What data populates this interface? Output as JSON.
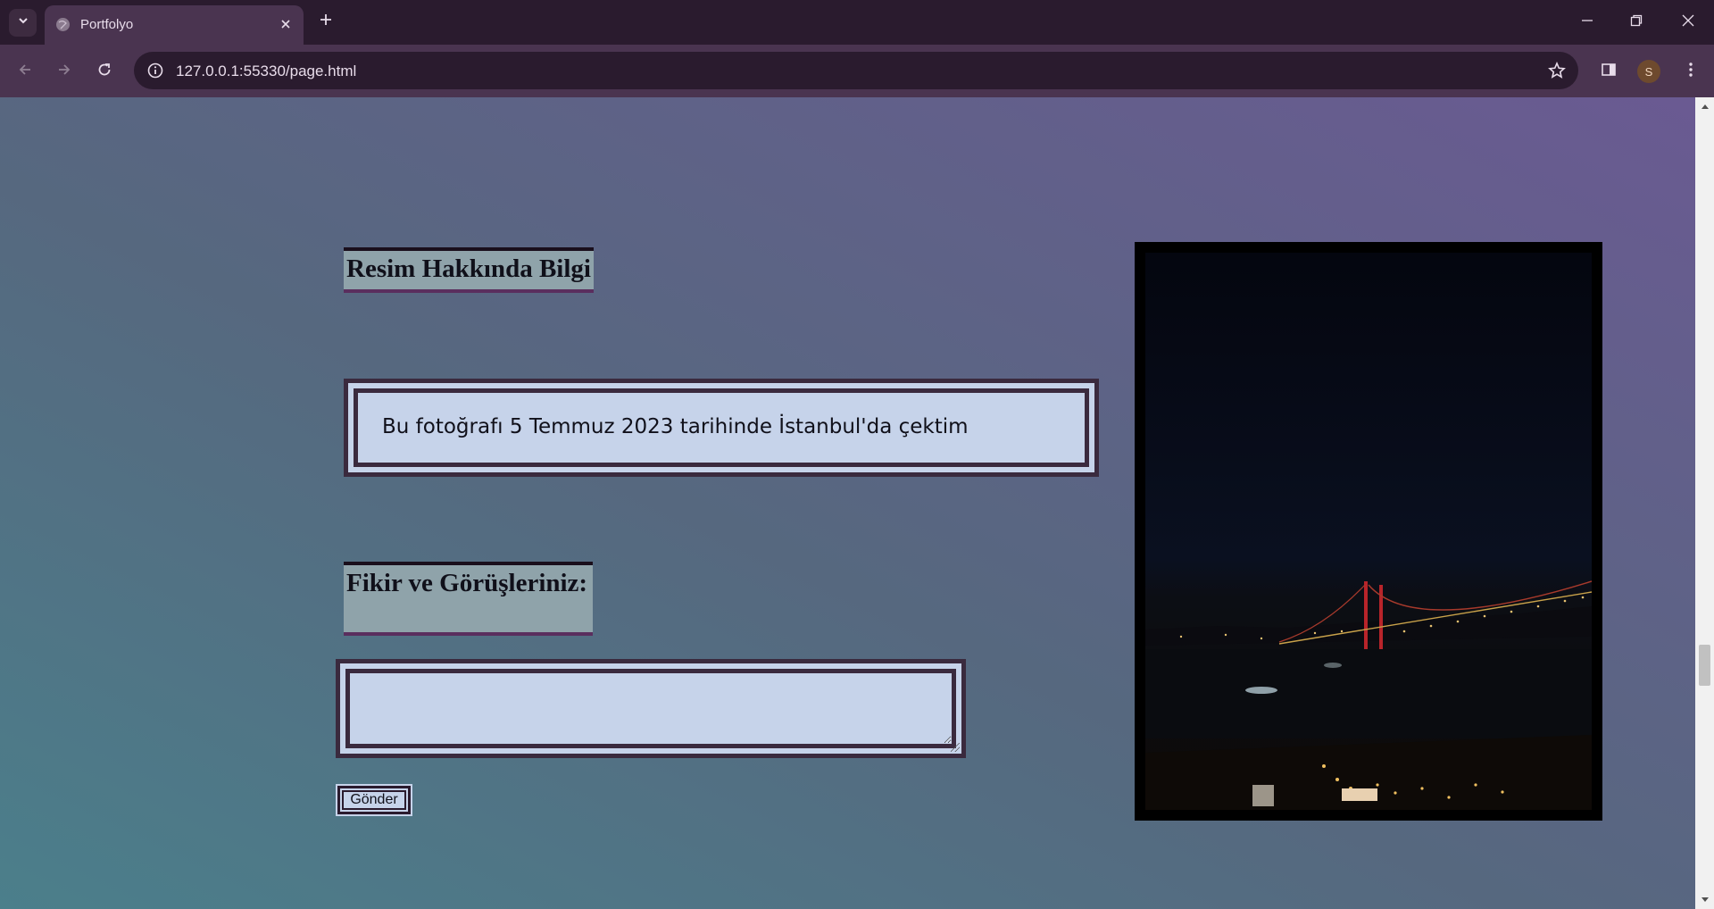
{
  "browser": {
    "tab_title": "Portfolyo",
    "url": "127.0.0.1:55330/page.html",
    "profile_initial": "S",
    "colors": {
      "frame": "#2a1b2e",
      "toolbar": "#4a3450"
    }
  },
  "icons": {
    "tab_search": "chevron-down-icon",
    "favicon": "globe-icon",
    "tab_close": "close-icon",
    "new_tab": "plus-icon",
    "back": "arrow-left-icon",
    "forward": "arrow-right-icon",
    "reload": "reload-icon",
    "site_info": "info-icon",
    "bookmark": "star-icon",
    "side_panel": "side-panel-icon",
    "menu": "kebab-menu-icon"
  },
  "page": {
    "info_heading": "Resim Hakkında Bilgi",
    "info_text": "Bu fotoğrafı 5 Temmuz 2023 tarihinde İstanbul'da çektim",
    "comment_heading": "Fikir ve Görüşleriniz:",
    "comment_value": "",
    "submit_label": "Gönder",
    "colors": {
      "box_fill": "#c6d3ea",
      "box_border": "#3a2a3e",
      "heading_fill": "#8fa3aa"
    }
  }
}
